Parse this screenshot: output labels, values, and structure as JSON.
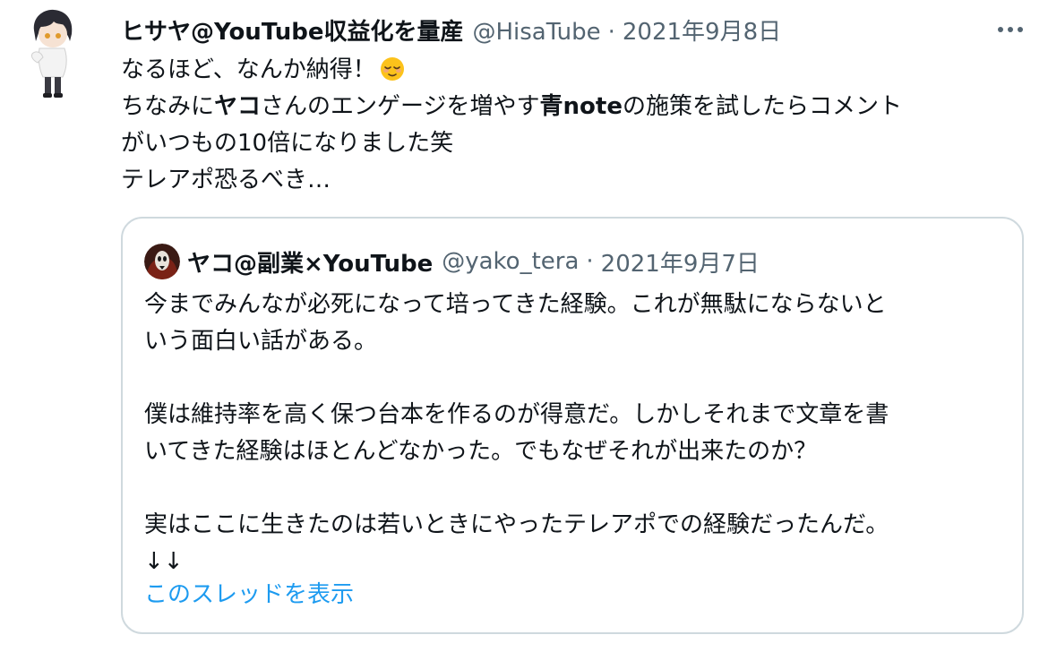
{
  "tweet": {
    "display_name": "ヒサヤ@YouTube収益化を量産",
    "handle": "@HisaTube",
    "separator": "·",
    "date": "2021年9月8日",
    "more_label": "···",
    "lines": {
      "l1": "なるほど、なんか納得！",
      "l2a": "ちなみに",
      "l2b": "ヤコ",
      "l2c": "さんのエンゲージを増やす",
      "l2d": "青note",
      "l2e": "の施策を試したらコメント",
      "l3": "がいつもの10倍になりました笑",
      "l4": "テレアポ恐るべき…"
    }
  },
  "quote": {
    "display_name": "ヤコ@副業×YouTube",
    "handle": "@yako_tera",
    "separator": "·",
    "date": "2021年9月7日",
    "lines": [
      "今までみんなが必死になって培ってきた経験。これが無駄にならないと",
      "いう面白い話がある。",
      "",
      "僕は維持率を高く保つ台本を作るのが得意だ。しかしそれまで文章を書",
      "いてきた経験はほとんどなかった。でもなぜそれが出来たのか？",
      "",
      "実はここに生きたのは若いときにやったテレアポでの経験だったんだ。",
      "↓↓"
    ],
    "show_thread_label": "このスレッドを表示"
  },
  "colors": {
    "text_primary": "#0f1419",
    "text_secondary": "#536471",
    "link": "#1d9bf0",
    "border": "#cfd9de"
  }
}
